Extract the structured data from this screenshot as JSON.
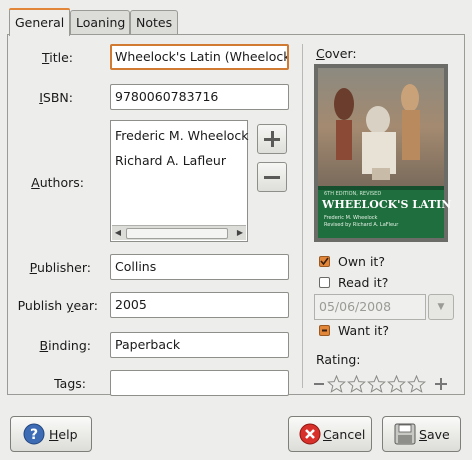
{
  "tabs": [
    "General",
    "Loaning",
    "Notes"
  ],
  "fields": {
    "title": {
      "label_pre": "",
      "label_u": "T",
      "label_post": "itle:",
      "value": "Wheelock's Latin (Wheelock"
    },
    "isbn": {
      "label_pre": "",
      "label_u": "I",
      "label_post": "SBN:",
      "value": "9780060783716"
    },
    "authors": {
      "label_pre": "",
      "label_u": "A",
      "label_post": "uthors:",
      "items": [
        "Frederic M. Wheelock",
        "Richard A. Lafleur"
      ]
    },
    "publisher": {
      "label_pre": "",
      "label_u": "P",
      "label_post": "ublisher:",
      "value": "Collins"
    },
    "publish_year": {
      "label_pre": "Publish ",
      "label_u": "y",
      "label_post": "ear:",
      "value": "2005"
    },
    "binding": {
      "label_pre": "",
      "label_u": "B",
      "label_post": "inding:",
      "value": "Paperback"
    },
    "tags": {
      "label": "Tags:",
      "value": ""
    }
  },
  "cover": {
    "label_pre": "",
    "label_u": "C",
    "label_post": "over:",
    "book_title": "WHEELOCK'S LATIN",
    "authors_line1": "Frederic M. Wheelock",
    "authors_line2": "Revised by Richard A. LaFleur",
    "edition": "6TH EDITION, REVISED"
  },
  "options": {
    "own": {
      "label": "Own it?",
      "checked": true
    },
    "read": {
      "label": "Read it?",
      "checked": false
    },
    "read_date": "05/06/2008",
    "want": {
      "label": "Want it?",
      "state": "mixed"
    },
    "rating_label": "Rating:",
    "rating_value": 0,
    "rating_max": 5
  },
  "buttons": {
    "help": "Help",
    "help_u": "H",
    "cancel": "Cancel",
    "cancel_u": "C",
    "save": "Save",
    "save_u": "S"
  },
  "colors": {
    "accent": "#e2863a",
    "cover_green": "#1f6f3e"
  }
}
